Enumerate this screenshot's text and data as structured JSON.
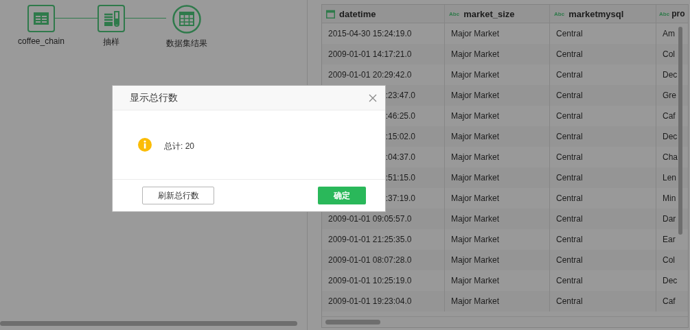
{
  "flow": {
    "nodes": [
      {
        "label": "coffee_chain",
        "kind": "source"
      },
      {
        "label": "抽样",
        "kind": "sample"
      },
      {
        "label": "数据集结果",
        "kind": "result"
      }
    ]
  },
  "table": {
    "columns": [
      {
        "label": "datetime",
        "kind": "date"
      },
      {
        "label": "market_size",
        "kind": "text",
        "badge": "Abc"
      },
      {
        "label": "marketmysql",
        "kind": "text",
        "badge": "Abc"
      },
      {
        "label": "pro",
        "kind": "text",
        "badge": "Abc"
      }
    ],
    "rows": [
      {
        "covered": false,
        "cells": [
          "2015-04-30 15:24:19.0",
          "Major Market",
          "Central",
          "Am"
        ]
      },
      {
        "covered": false,
        "cells": [
          "2009-01-01 14:17:21.0",
          "Major Market",
          "Central",
          "Col"
        ]
      },
      {
        "covered": false,
        "cells": [
          "2009-01-01 20:29:42.0",
          "Major Market",
          "Central",
          "Dec"
        ]
      },
      {
        "covered": true,
        "cells": [
          ":23:47.0",
          "Major Market",
          "Central",
          "Gre"
        ]
      },
      {
        "covered": true,
        "cells": [
          ":46:25.0",
          "Major Market",
          "Central",
          "Caf"
        ]
      },
      {
        "covered": true,
        "cells": [
          ":15:02.0",
          "Major Market",
          "Central",
          "Dec"
        ]
      },
      {
        "covered": true,
        "cells": [
          ":04:37.0",
          "Major Market",
          "Central",
          "Cha"
        ]
      },
      {
        "covered": true,
        "cells": [
          ":51:15.0",
          "Major Market",
          "Central",
          "Len"
        ]
      },
      {
        "covered": true,
        "cells": [
          ":37:19.0",
          "Major Market",
          "Central",
          "Min"
        ]
      },
      {
        "covered": false,
        "cells": [
          "2009-01-01 09:05:57.0",
          "Major Market",
          "Central",
          "Dar"
        ]
      },
      {
        "covered": false,
        "cells": [
          "2009-01-01 21:25:35.0",
          "Major Market",
          "Central",
          "Ear"
        ]
      },
      {
        "covered": false,
        "cells": [
          "2009-01-01 08:07:28.0",
          "Major Market",
          "Central",
          "Col"
        ]
      },
      {
        "covered": false,
        "cells": [
          "2009-01-01 10:25:19.0",
          "Major Market",
          "Central",
          "Dec"
        ]
      },
      {
        "covered": false,
        "cells": [
          "2009-01-01 19:23:04.0",
          "Major Market",
          "Central",
          "Caf"
        ]
      }
    ]
  },
  "dialog": {
    "title": "显示总行数",
    "message": "总计: 20",
    "buttons": [
      {
        "label": "刷新总行数",
        "kind": "secondary"
      },
      {
        "label": "确定",
        "kind": "primary"
      }
    ]
  }
}
